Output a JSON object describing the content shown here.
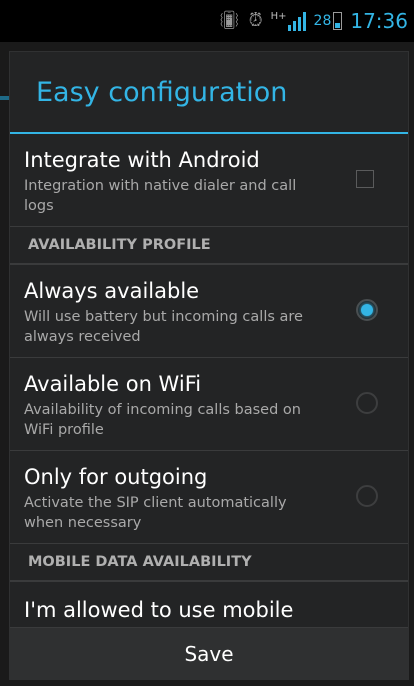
{
  "status_bar": {
    "network_type": "H+",
    "battery_level": "28",
    "time": "17:36"
  },
  "dialog": {
    "title": "Easy configuration",
    "integrate": {
      "title": "Integrate with Android",
      "summary": "Integration with native dialer and call logs",
      "checked": false
    },
    "availability_header": "AVAILABILITY PROFILE",
    "availability_options": [
      {
        "title": "Always available",
        "summary": "Will use battery but incoming calls are always received",
        "selected": true
      },
      {
        "title": "Available on WiFi",
        "summary": "Availability of incoming calls based on WiFi profile",
        "selected": false
      },
      {
        "title": "Only for outgoing",
        "summary": "Activate the SIP client automatically when necessary",
        "selected": false
      }
    ],
    "mobile_data_header": "MOBILE DATA AVAILABILITY",
    "mobile_data_item": {
      "title": "I'm allowed to use mobile",
      "checked": false
    },
    "save_label": "Save"
  },
  "colors": {
    "accent": "#33b5e5",
    "dialog_bg": "#232425",
    "summary_text": "#a9a9a9"
  }
}
